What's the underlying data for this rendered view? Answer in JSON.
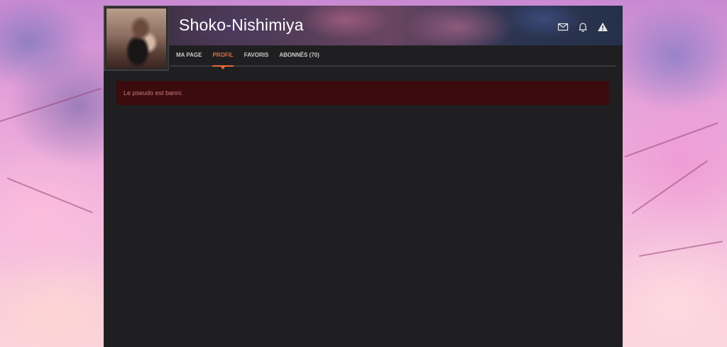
{
  "profile": {
    "username": "Shoko-Nishimiya"
  },
  "header_icons": [
    {
      "name": "envelope-icon"
    },
    {
      "name": "bell-icon"
    },
    {
      "name": "warning-icon"
    }
  ],
  "nav": {
    "items": [
      {
        "label": "MA PAGE",
        "active": false
      },
      {
        "label": "PROFIL",
        "active": true
      },
      {
        "label": "FAVORIS",
        "active": false
      },
      {
        "label": "ABONNÉS (70)",
        "active": false
      }
    ]
  },
  "alert": {
    "message": "Le pseudo est banni."
  },
  "colors": {
    "accent": "#e26b3a",
    "frame_bg": "#1f1f21",
    "alert_bg": "#3b0b0e",
    "alert_text": "#c67a7e"
  }
}
